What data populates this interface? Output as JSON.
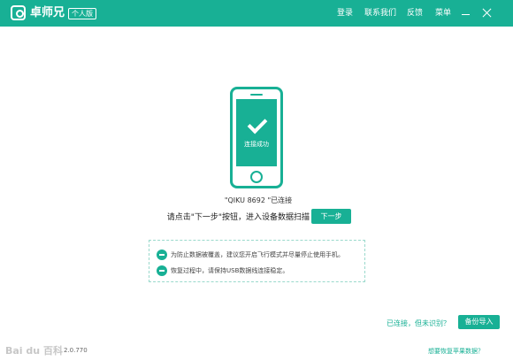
{
  "titlebar": {
    "app_title": "卓师兄",
    "edition_badge": "个人版",
    "menu": [
      "登录",
      "联系我们",
      "反馈",
      "菜单"
    ],
    "accent_color": "#18b095"
  },
  "phone": {
    "status_text": "连接成功"
  },
  "main": {
    "device_label": "\"QIKU 8692 \"已连接",
    "instruction": "请点击\"下一步\"按钮，进入设备数据扫描",
    "next_button": "下一步"
  },
  "tips": [
    "为防止数据被覆盖，建议您开启飞行模式并尽量停止使用手机。",
    "恢复过程中，请保持USB数据线连接稳定。"
  ],
  "footer": {
    "connected_link": "已连接，但未识别？",
    "backup_button": "备份导入",
    "watermark": "Bai du 百科",
    "version": "2.0.770",
    "recover_link": "想要恢复苹果数据？"
  }
}
